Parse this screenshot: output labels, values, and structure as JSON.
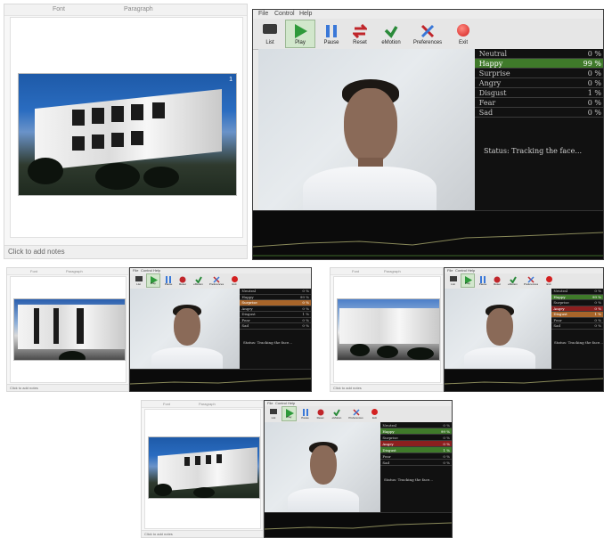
{
  "presentation": {
    "header_left": "Font",
    "header_right": "Paragraph",
    "slide_number": "1",
    "notes_placeholder": "Click to add notes"
  },
  "app": {
    "menu": [
      "File",
      "Control",
      "Help"
    ],
    "toolbar": [
      "List",
      "Play",
      "Pause",
      "Reset",
      "eMotion",
      "Preferences",
      "Exit"
    ],
    "emotions": [
      {
        "label": "Neutral",
        "value": "0 %"
      },
      {
        "label": "Happy",
        "value": "99 %"
      },
      {
        "label": "Surprise",
        "value": "0 %"
      },
      {
        "label": "Angry",
        "value": "0 %"
      },
      {
        "label": "Disgust",
        "value": "1 %"
      },
      {
        "label": "Fear",
        "value": "0 %"
      },
      {
        "label": "Sad",
        "value": "0 %"
      }
    ],
    "status": "Status:  Tracking the face..."
  },
  "colors": {
    "play_green": "#2e9a3a",
    "pause_blue": "#3a78d8",
    "reset_red": "#c0252a",
    "emotion_green": "#2a8a3a",
    "highlight_green": "#3f7a2a"
  }
}
